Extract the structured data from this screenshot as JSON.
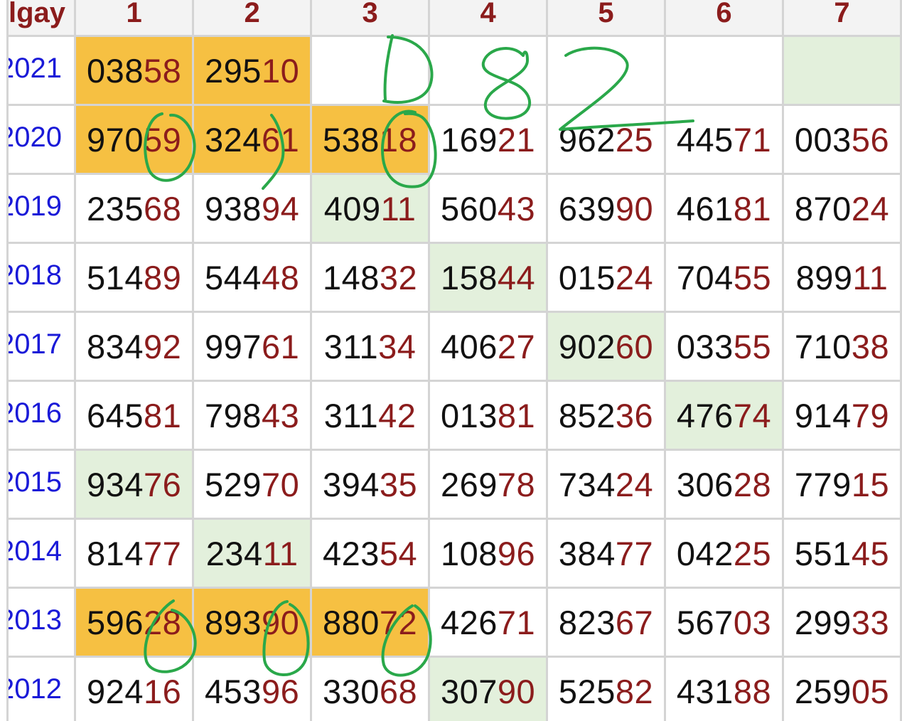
{
  "table": {
    "corner_label": "lgay",
    "columns": [
      "1",
      "2",
      "3",
      "4",
      "5",
      "6",
      "7"
    ],
    "rows": [
      {
        "year": "2021",
        "cells": [
          {
            "head": "038",
            "tail": "58",
            "bg": "yellow"
          },
          {
            "head": "295",
            "tail": "10",
            "bg": "yellow"
          },
          {
            "head": "",
            "tail": "",
            "bg": "white"
          },
          {
            "head": "",
            "tail": "",
            "bg": "white"
          },
          {
            "head": "",
            "tail": "",
            "bg": "white"
          },
          {
            "head": "",
            "tail": "",
            "bg": "white"
          },
          {
            "head": "",
            "tail": "",
            "bg": "green"
          }
        ]
      },
      {
        "year": "2020",
        "cells": [
          {
            "head": "970",
            "tail": "59",
            "bg": "yellow"
          },
          {
            "head": "324",
            "tail": "61",
            "bg": "yellow"
          },
          {
            "head": "538",
            "tail": "18",
            "bg": "yellow"
          },
          {
            "head": "169",
            "tail": "21",
            "bg": "white"
          },
          {
            "head": "962",
            "tail": "25",
            "bg": "white"
          },
          {
            "head": "445",
            "tail": "71",
            "bg": "white"
          },
          {
            "head": "003",
            "tail": "56",
            "bg": "white"
          }
        ]
      },
      {
        "year": "2019",
        "cells": [
          {
            "head": "235",
            "tail": "68",
            "bg": "white"
          },
          {
            "head": "938",
            "tail": "94",
            "bg": "white"
          },
          {
            "head": "409",
            "tail": "11",
            "bg": "green"
          },
          {
            "head": "560",
            "tail": "43",
            "bg": "white"
          },
          {
            "head": "639",
            "tail": "90",
            "bg": "white"
          },
          {
            "head": "461",
            "tail": "81",
            "bg": "white"
          },
          {
            "head": "870",
            "tail": "24",
            "bg": "white"
          }
        ]
      },
      {
        "year": "2018",
        "cells": [
          {
            "head": "514",
            "tail": "89",
            "bg": "white"
          },
          {
            "head": "544",
            "tail": "48",
            "bg": "white"
          },
          {
            "head": "148",
            "tail": "32",
            "bg": "white"
          },
          {
            "head": "158",
            "tail": "44",
            "bg": "green"
          },
          {
            "head": "015",
            "tail": "24",
            "bg": "white"
          },
          {
            "head": "704",
            "tail": "55",
            "bg": "white"
          },
          {
            "head": "899",
            "tail": "11",
            "bg": "white"
          }
        ]
      },
      {
        "year": "2017",
        "cells": [
          {
            "head": "834",
            "tail": "92",
            "bg": "white"
          },
          {
            "head": "997",
            "tail": "61",
            "bg": "white"
          },
          {
            "head": "311",
            "tail": "34",
            "bg": "white"
          },
          {
            "head": "406",
            "tail": "27",
            "bg": "white"
          },
          {
            "head": "902",
            "tail": "60",
            "bg": "green"
          },
          {
            "head": "033",
            "tail": "55",
            "bg": "white"
          },
          {
            "head": "710",
            "tail": "38",
            "bg": "white"
          }
        ]
      },
      {
        "year": "2016",
        "cells": [
          {
            "head": "645",
            "tail": "81",
            "bg": "white"
          },
          {
            "head": "798",
            "tail": "43",
            "bg": "white"
          },
          {
            "head": "311",
            "tail": "42",
            "bg": "white"
          },
          {
            "head": "013",
            "tail": "81",
            "bg": "white"
          },
          {
            "head": "852",
            "tail": "36",
            "bg": "white"
          },
          {
            "head": "476",
            "tail": "74",
            "bg": "green"
          },
          {
            "head": "914",
            "tail": "79",
            "bg": "white"
          }
        ]
      },
      {
        "year": "2015",
        "cells": [
          {
            "head": "934",
            "tail": "76",
            "bg": "green"
          },
          {
            "head": "529",
            "tail": "70",
            "bg": "white"
          },
          {
            "head": "394",
            "tail": "35",
            "bg": "white"
          },
          {
            "head": "269",
            "tail": "78",
            "bg": "white"
          },
          {
            "head": "734",
            "tail": "24",
            "bg": "white"
          },
          {
            "head": "306",
            "tail": "28",
            "bg": "white"
          },
          {
            "head": "779",
            "tail": "15",
            "bg": "white"
          }
        ]
      },
      {
        "year": "2014",
        "cells": [
          {
            "head": "814",
            "tail": "77",
            "bg": "white"
          },
          {
            "head": "234",
            "tail": "11",
            "bg": "green"
          },
          {
            "head": "423",
            "tail": "54",
            "bg": "white"
          },
          {
            "head": "108",
            "tail": "96",
            "bg": "white"
          },
          {
            "head": "384",
            "tail": "77",
            "bg": "white"
          },
          {
            "head": "042",
            "tail": "25",
            "bg": "white"
          },
          {
            "head": "551",
            "tail": "45",
            "bg": "white"
          }
        ]
      },
      {
        "year": "2013",
        "cells": [
          {
            "head": "596",
            "tail": "28",
            "bg": "yellow"
          },
          {
            "head": "893",
            "tail": "90",
            "bg": "yellow"
          },
          {
            "head": "880",
            "tail": "72",
            "bg": "yellow"
          },
          {
            "head": "426",
            "tail": "71",
            "bg": "white"
          },
          {
            "head": "823",
            "tail": "67",
            "bg": "white"
          },
          {
            "head": "567",
            "tail": "03",
            "bg": "white"
          },
          {
            "head": "299",
            "tail": "33",
            "bg": "white"
          }
        ]
      },
      {
        "year": "2012",
        "cells": [
          {
            "head": "924",
            "tail": "16",
            "bg": "white"
          },
          {
            "head": "453",
            "tail": "96",
            "bg": "white"
          },
          {
            "head": "330",
            "tail": "68",
            "bg": "white"
          },
          {
            "head": "307",
            "tail": "90",
            "bg": "green"
          },
          {
            "head": "525",
            "tail": "82",
            "bg": "white"
          },
          {
            "head": "431",
            "tail": "88",
            "bg": "white"
          },
          {
            "head": "259",
            "tail": "05",
            "bg": "white"
          }
        ]
      }
    ]
  },
  "colors": {
    "header_text": "#8b1c1c",
    "year_text": "#1a1ad8",
    "digit_head": "#111111",
    "digit_tail": "#8b1c1c",
    "highlight_yellow": "#f6c042",
    "highlight_green": "#e3f0dc",
    "annotation_ink": "#2aa84a"
  },
  "annotation": {
    "handwritten_text": "D82",
    "icon": "handwritten-ink-marks"
  }
}
